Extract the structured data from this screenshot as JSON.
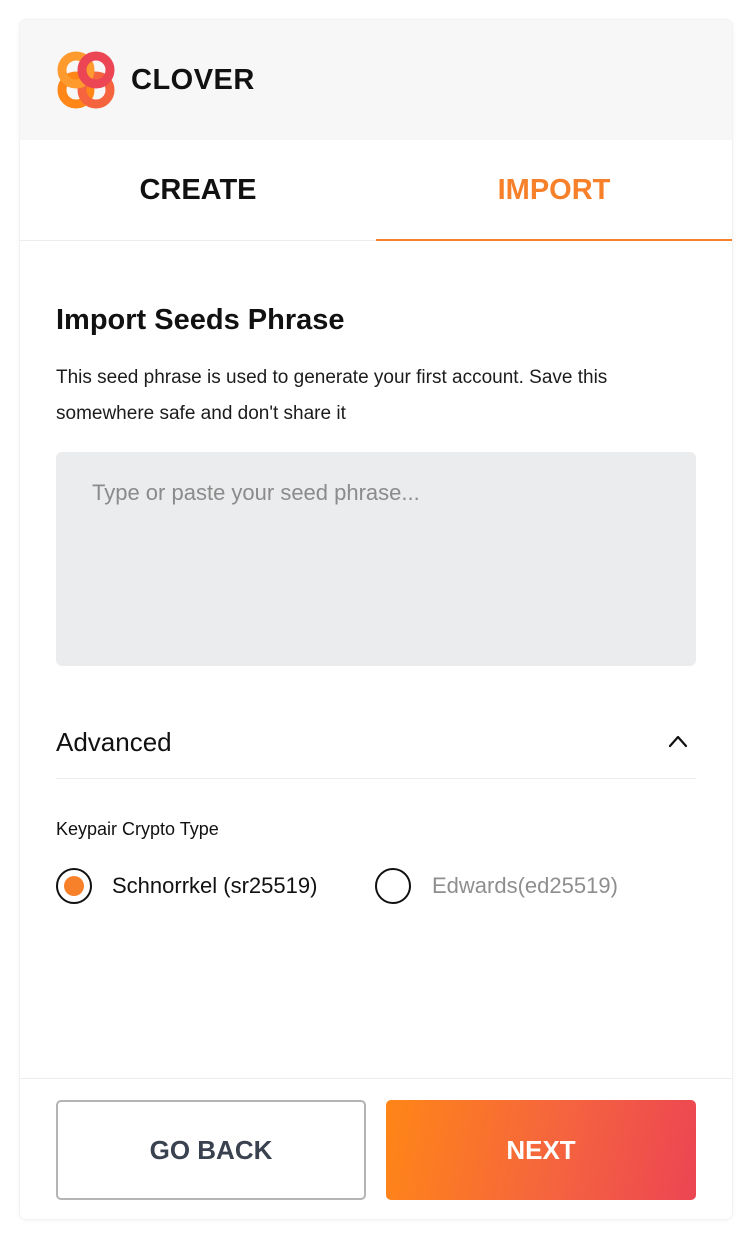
{
  "header": {
    "logo_icon": "clover-logo-icon",
    "brand": "CLOVER"
  },
  "tabs": [
    {
      "label": "CREATE",
      "active": false
    },
    {
      "label": "IMPORT",
      "active": true
    }
  ],
  "main": {
    "title": "Import Seeds Phrase",
    "description": "This seed phrase is used to generate your first account. Save this somewhere safe and don't share it",
    "seed_input": {
      "value": "",
      "placeholder": "Type or paste your seed phrase..."
    },
    "advanced": {
      "label": "Advanced",
      "icon": "chevron-up-icon",
      "expanded": true
    },
    "keypair": {
      "label": "Keypair Crypto Type",
      "options": [
        {
          "label": "Schnorrkel (sr25519)",
          "selected": true
        },
        {
          "label": "Edwards(ed25519)",
          "selected": false
        }
      ]
    }
  },
  "footer": {
    "back_label": "GO BACK",
    "next_label": "NEXT"
  },
  "colors": {
    "accent": "#F7812B",
    "gradient_start": "#FF8617",
    "gradient_end": "#EC4553",
    "input_bg": "#EBECEE",
    "header_bg": "#F7F7F7"
  }
}
